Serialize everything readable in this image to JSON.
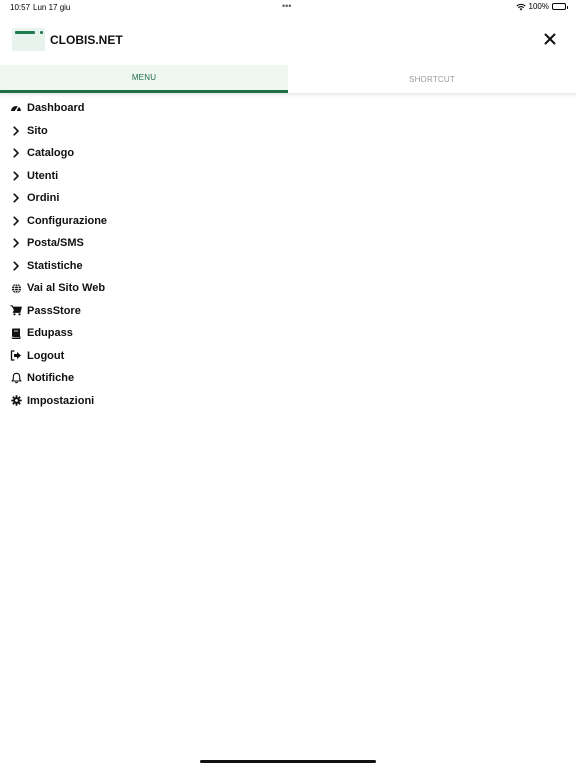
{
  "status_bar": {
    "time": "10:57",
    "date": "Lun 17 giu",
    "multitask_dots": "•••",
    "battery": "100%"
  },
  "header": {
    "brand": "CLOBIS.NET",
    "logo_icon": "clobis-logo",
    "close_icon": "close-icon"
  },
  "tabs": [
    {
      "label": "MENU",
      "active": true
    },
    {
      "label": "SHORTCUT",
      "active": false
    }
  ],
  "menu": {
    "items": [
      {
        "label": "Dashboard",
        "icon": "dashboard-icon"
      },
      {
        "label": "Sito",
        "icon": "chevron-right-icon"
      },
      {
        "label": "Catalogo",
        "icon": "chevron-right-icon"
      },
      {
        "label": "Utenti",
        "icon": "chevron-right-icon"
      },
      {
        "label": "Ordini",
        "icon": "chevron-right-icon"
      },
      {
        "label": "Configurazione",
        "icon": "chevron-right-icon"
      },
      {
        "label": "Posta/SMS",
        "icon": "chevron-right-icon"
      },
      {
        "label": "Statistiche",
        "icon": "chevron-right-icon"
      },
      {
        "label": "Vai al Sito Web",
        "icon": "globe-icon"
      },
      {
        "label": "PassStore",
        "icon": "cart-icon"
      },
      {
        "label": "Edupass",
        "icon": "book-icon"
      },
      {
        "label": "Logout",
        "icon": "logout-icon"
      },
      {
        "label": "Notifiche",
        "icon": "bell-icon"
      },
      {
        "label": "Impostazioni",
        "icon": "gear-icon"
      }
    ]
  },
  "colors": {
    "accent": "#1f6e47",
    "tab_active_bg": "#eef6f1",
    "tab_inactive_text": "#9a9a9a"
  }
}
